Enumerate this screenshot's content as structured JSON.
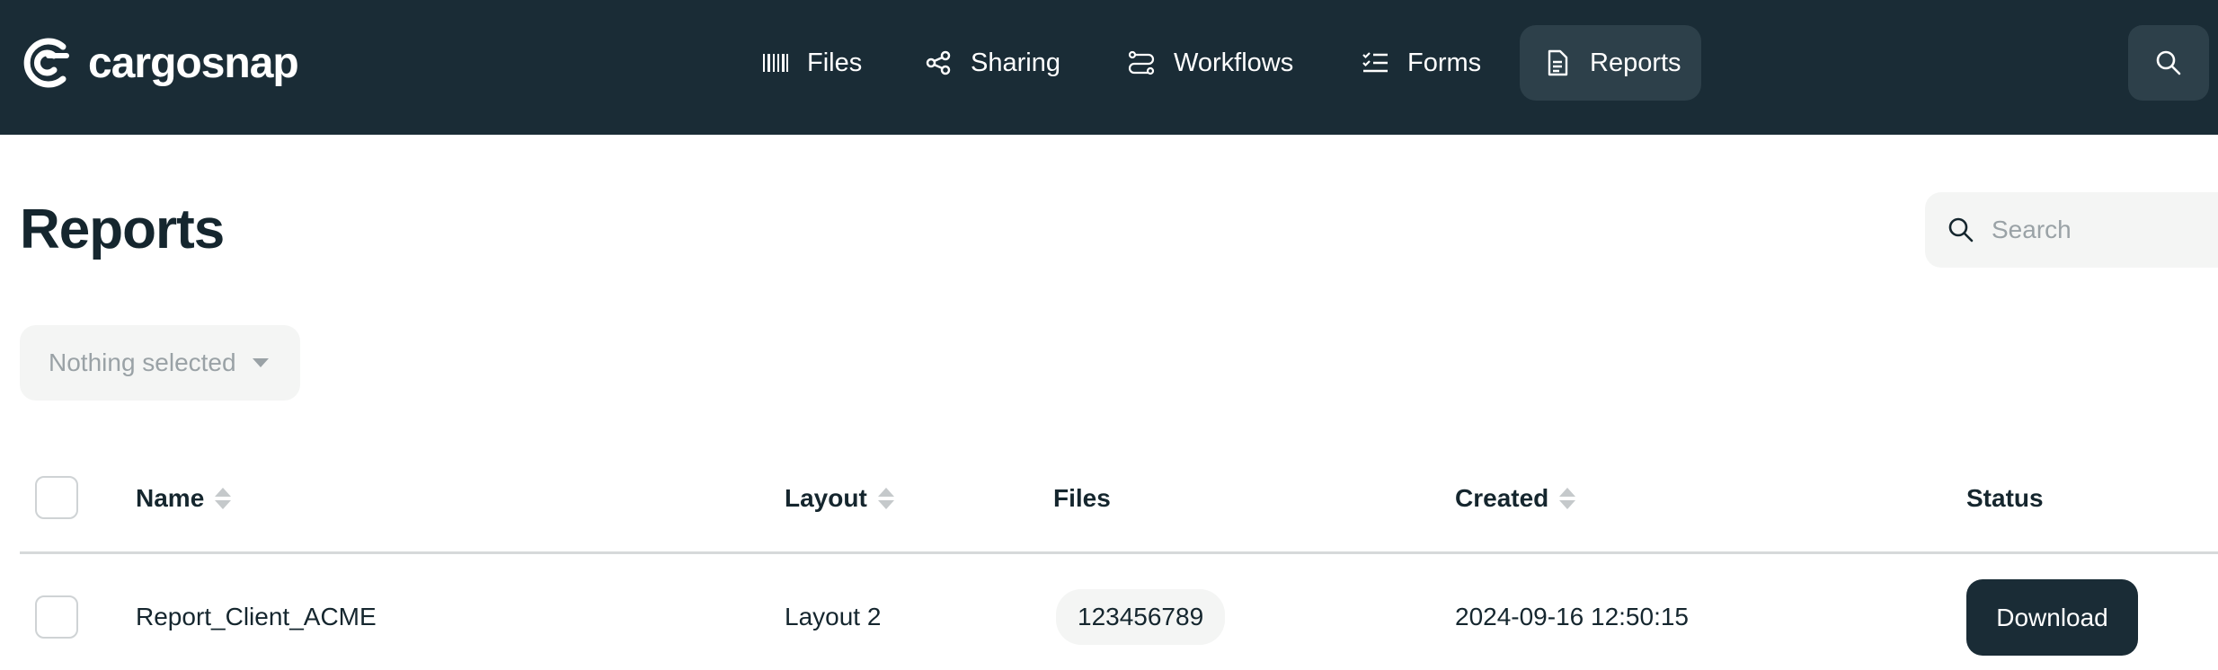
{
  "app": {
    "logo_text": "cargosnap"
  },
  "nav": {
    "items": [
      {
        "label": "Files",
        "icon": "barcode-icon"
      },
      {
        "label": "Sharing",
        "icon": "share-icon"
      },
      {
        "label": "Workflows",
        "icon": "workflow-icon"
      },
      {
        "label": "Forms",
        "icon": "checklist-icon"
      },
      {
        "label": "Reports",
        "icon": "document-icon",
        "active": true
      }
    ],
    "search_icon": "search-icon"
  },
  "page": {
    "title": "Reports",
    "search_placeholder": "Search",
    "filter_select": "Nothing selected"
  },
  "table": {
    "columns": [
      "Name",
      "Layout",
      "Files",
      "Created",
      "Status"
    ],
    "sortable": [
      "Name",
      "Layout",
      "Created"
    ],
    "rows": [
      {
        "name": "Report_Client_ACME",
        "layout": "Layout 2",
        "files": "123456789",
        "created": "2024-09-16 12:50:15",
        "status": "Download"
      }
    ]
  },
  "colors": {
    "topbar": "#1a2c36",
    "nav_active": "#2d404a",
    "text": "#15262e",
    "muted": "#9aa2a6",
    "field_bg": "#f4f5f4"
  }
}
